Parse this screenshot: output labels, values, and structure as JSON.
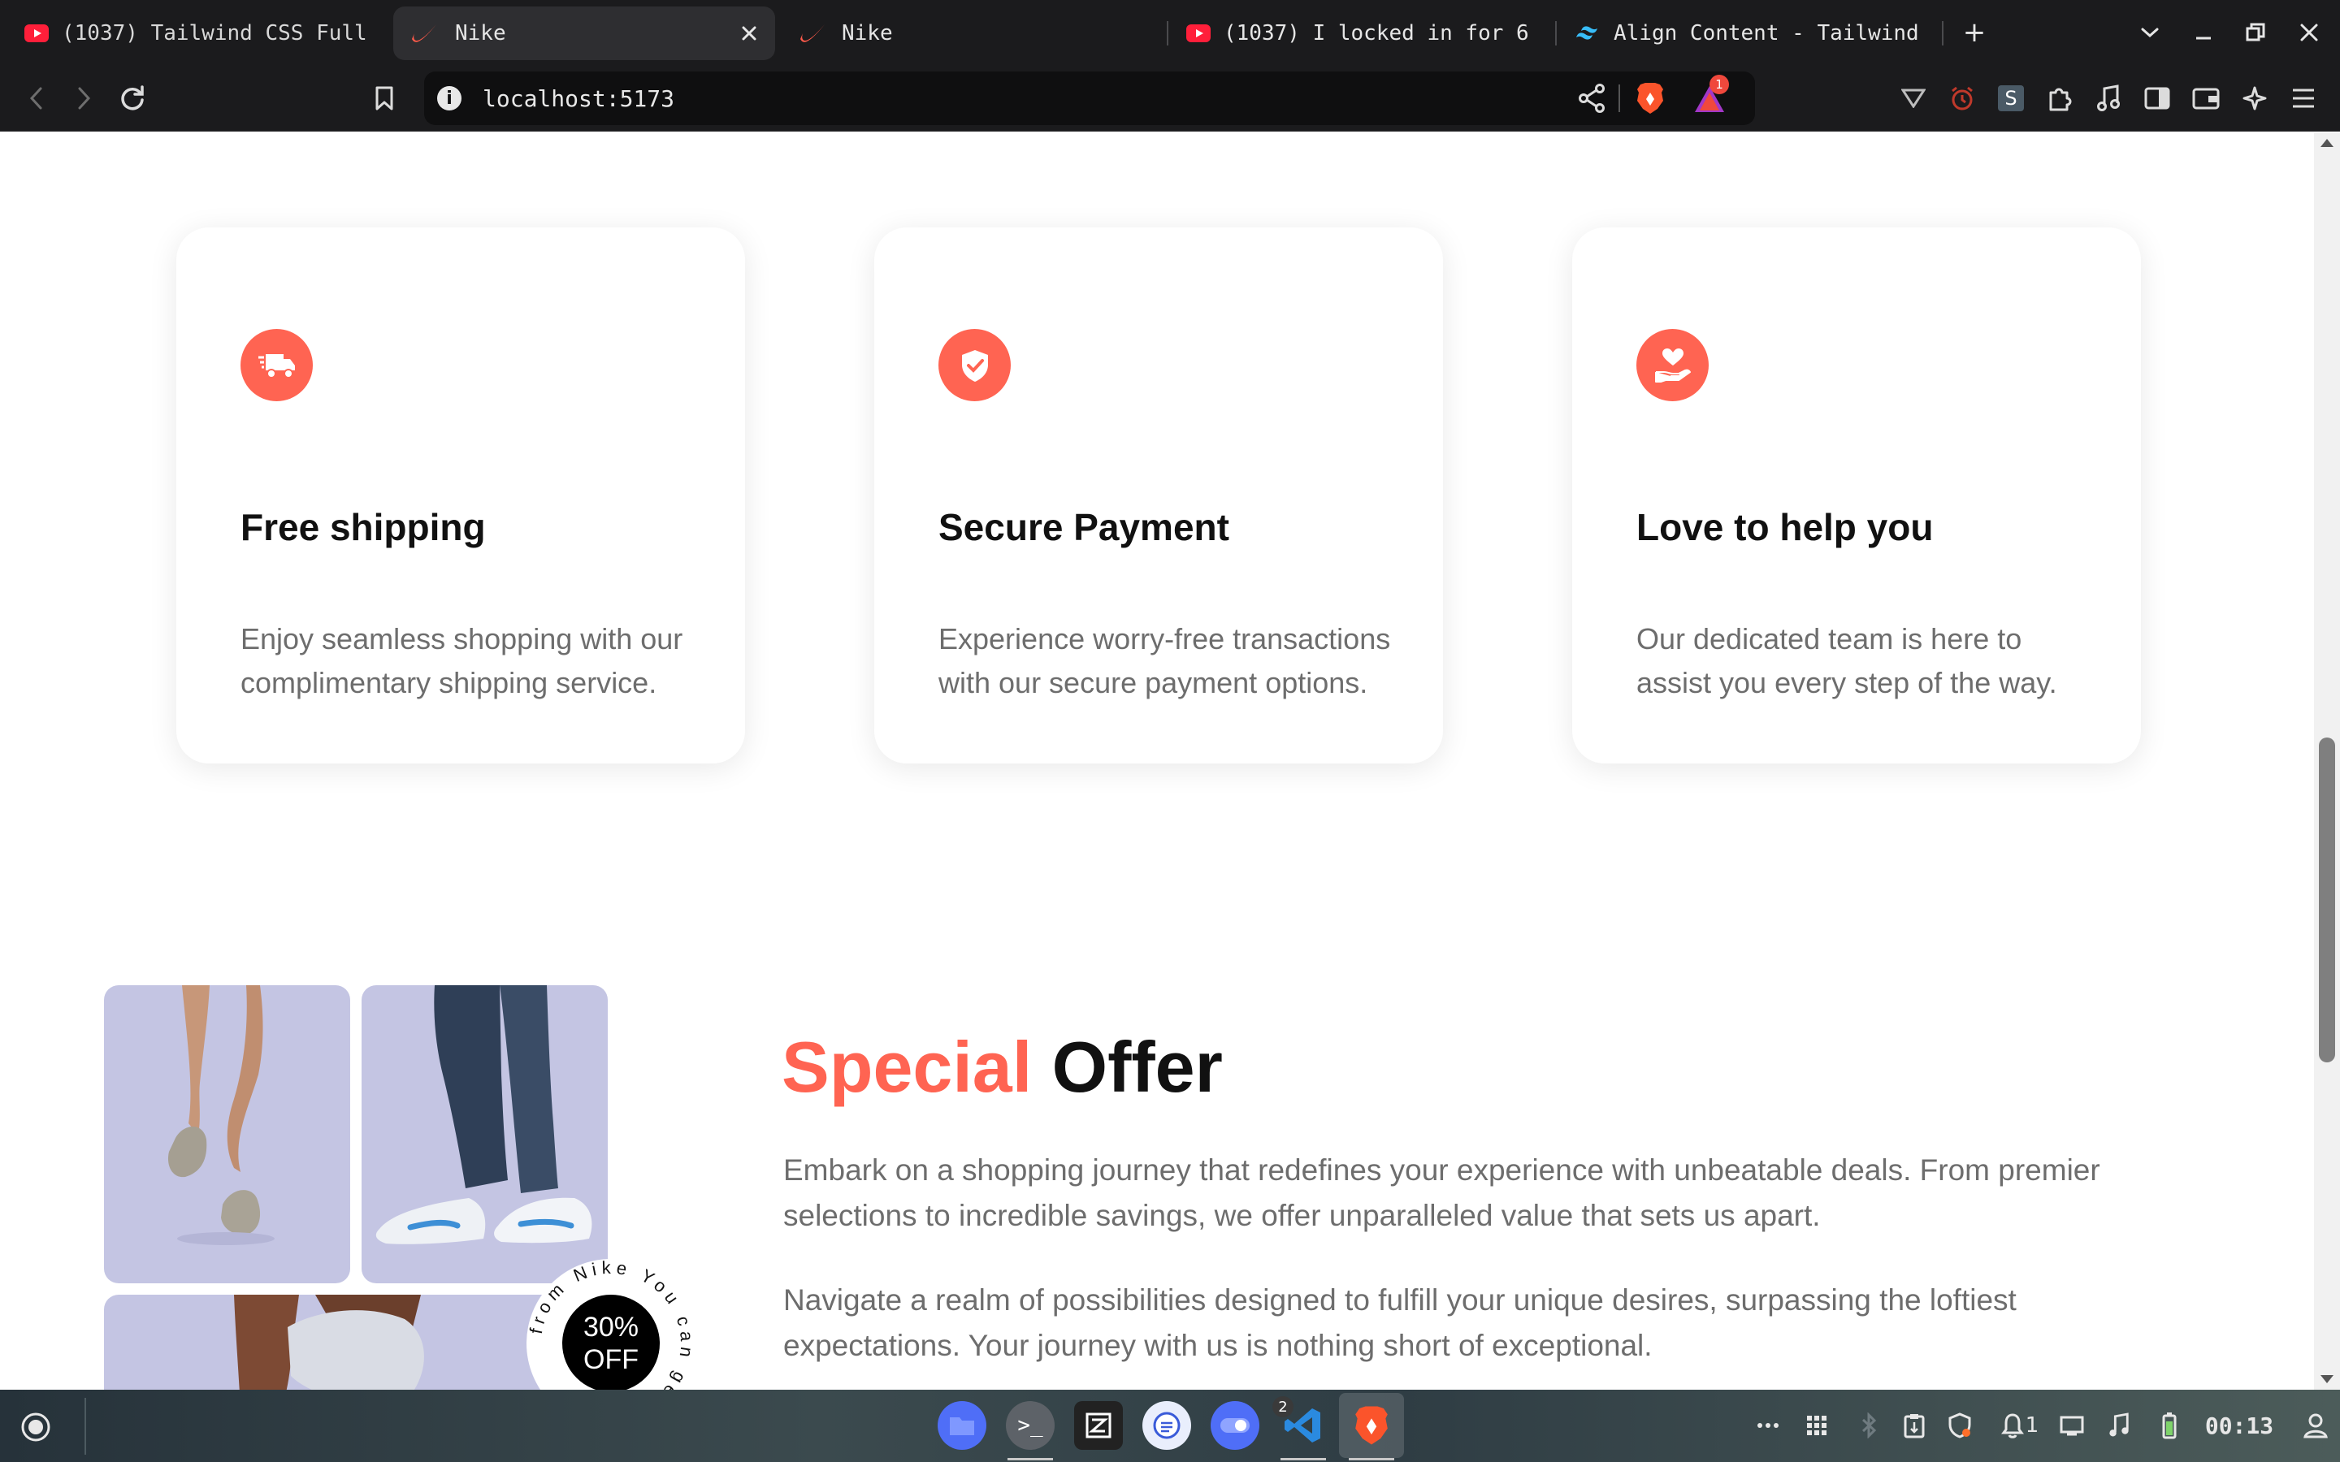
{
  "browser": {
    "tabs": [
      {
        "title": "(1037) Tailwind CSS Full",
        "icon": "youtube-icon",
        "active": false
      },
      {
        "title": "Nike",
        "icon": "nike-icon",
        "active": true
      },
      {
        "title": "Nike",
        "icon": "nike-icon",
        "active": false
      },
      {
        "title": "(1037) I locked in for 6",
        "icon": "youtube-icon",
        "active": false
      },
      {
        "title": "Align Content - Tailwind",
        "icon": "tailwind-icon",
        "active": false
      }
    ],
    "new_tab": "+",
    "url": "localhost:5173",
    "shield_badge": "1"
  },
  "services": [
    {
      "icon": "truck-icon",
      "title": "Free shipping",
      "description": "Enjoy seamless shopping with our complimentary shipping service."
    },
    {
      "icon": "shield-check-icon",
      "title": "Secure Payment",
      "description": "Experience worry-free transactions with our secure payment options."
    },
    {
      "icon": "heart-hand-icon",
      "title": "Love to help you",
      "description": "Our dedicated team is here to assist you every step of the way."
    }
  ],
  "offer": {
    "title_accent": "Special",
    "title_rest": "Offer",
    "paragraph_1": "Embark on a shopping journey that redefines your experience with unbeatable deals. From premier selections to incredible savings, we offer unparalleled value that sets us apart.",
    "paragraph_2": "Navigate a realm of possibilities designed to fulfill your unique desires, surpassing the loftiest expectations. Your journey with us is nothing short of exceptional.",
    "badge_percent": "30%",
    "badge_off": "OFF",
    "badge_ring_text": "from Nike You can get"
  },
  "taskbar": {
    "workspace_badge": "2",
    "notifications": "1",
    "clock": "00:13"
  },
  "colors": {
    "accent": "#ff6452",
    "tile": "#c4c5e3"
  }
}
